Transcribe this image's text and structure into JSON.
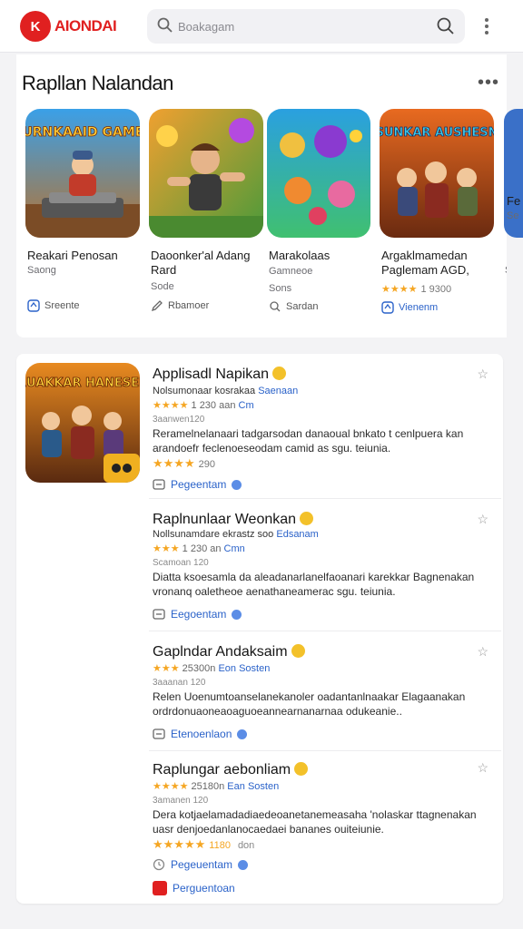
{
  "header": {
    "logo_text": "AIONDAI",
    "logo_mark": "K",
    "search_placeholder": "Boakagam"
  },
  "featured": {
    "title": "Rapllan Nalandan",
    "more": "•••",
    "cards": [
      {
        "name": "Reakari Penosan",
        "sub": "Saong",
        "action": "Sreente"
      },
      {
        "name": "Daoonker'al Adang Rard",
        "sub": "Sode",
        "action": "Rbamoer"
      },
      {
        "name": "Marakolaas",
        "sub": "Gamneoe",
        "sub2": "Sons",
        "action": "Sardan"
      },
      {
        "name": "Argaklmamedan Paglemam AGD,",
        "stars": "★★★★",
        "rating": "1 9300",
        "action": "Vienenm"
      },
      {
        "name": "Fe",
        "sub": "Se"
      }
    ],
    "thumb_titles": [
      "PURNKAAID GAMEE",
      "SUNKAR AUSHESN"
    ]
  },
  "list": {
    "thumb_title": "RUAKKAR HANESER",
    "entries": [
      {
        "title": "Applisadl Napikan",
        "subtitle": "Nolsumonaar kosrakaa",
        "subtitle_hl": "Saenaan",
        "stars": "★★★★",
        "meta": "1 230 aan",
        "meta_hl": "Cm",
        "small": "3aanwen120",
        "desc": "Reramelnelanaari tadgarsodan danaoual bnkato t cenlpuera kan arandoefr feclenoeseodam camid as sgu. teiunia.",
        "rating2": "★★★★",
        "rating2_num": "290",
        "action": "Pegeentam"
      },
      {
        "title": "Raplnunlaar Weonkan",
        "subtitle": "Nollsunamdare ekrastz soo",
        "subtitle_hl": "Edsanam",
        "stars": "★★★",
        "meta": "1 230 an",
        "meta_hl": "Cmn",
        "small": "Scamoan 120",
        "desc": "Diatta ksoesamla da aleadanarlanelfaoanari karekkar Bagnenakan vronanq oaletheoe aenathaneamerac sgu. teiunia.",
        "action": "Eegoentam"
      },
      {
        "title": "Gaplndar Andaksaim",
        "stars": "★★★",
        "meta": "25300n",
        "meta_hl": "Eon",
        "meta_hl2": "Sosten",
        "small": "3aaanan 120",
        "desc": "Relen Uoenumtoanselanekanoler oadantanlnaakar Elagaanakan ordrdonuaoneaoaguoeannearnanarnaa odukeanie..",
        "action": "Etenoenlaon"
      },
      {
        "title": "Raplungar aebonliam",
        "stars": "★★★★",
        "meta": "25180n",
        "meta_hl": "Ean",
        "meta_hl2": "Sosten",
        "small": "3amanen 120",
        "desc": "Dera kotjaelamadadiaedeoanetanemeasaha 'nolaskar ttagnenakan uasr denjoedanlanocaedaei bananes ouiteiunie.",
        "rating2": "★★★★★",
        "rating2_num": "1180",
        "rating2_muted": "don",
        "action": "Pegeuentam",
        "action2": "Perguentoan"
      }
    ]
  },
  "colors": {
    "accent": "#2a62c9",
    "brand": "#e02020",
    "star": "#f5a623"
  }
}
